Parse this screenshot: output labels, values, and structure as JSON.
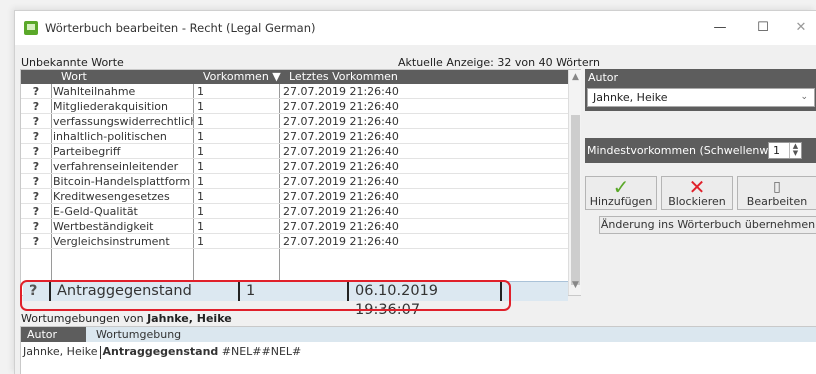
{
  "window": {
    "title": "Wörterbuch bearbeiten - Recht (Legal German)",
    "minimize": "—",
    "maximize": "☐",
    "close": "✕"
  },
  "left": {
    "label": "Unbekannte Worte",
    "count_label": "Aktuelle Anzeige: 32 von 40 Wörtern",
    "columns": [
      "Wort",
      "Vorkommen ▼",
      "Letztes Vorkommen"
    ],
    "rows": [
      {
        "q": "?",
        "word": "Wahlteilnahme",
        "count": "1",
        "date": "27.07.2019 21:26:40"
      },
      {
        "q": "?",
        "word": "Mitgliederakquisition",
        "count": "1",
        "date": "27.07.2019 21:26:40"
      },
      {
        "q": "?",
        "word": "verfassungswiderrechtliche",
        "count": "1",
        "date": "27.07.2019 21:26:40"
      },
      {
        "q": "?",
        "word": "inhaltlich-politischen",
        "count": "1",
        "date": "27.07.2019 21:26:40"
      },
      {
        "q": "?",
        "word": "Parteibegriff",
        "count": "1",
        "date": "27.07.2019 21:26:40"
      },
      {
        "q": "?",
        "word": "verfahrenseinleitender",
        "count": "1",
        "date": "27.07.2019 21:26:40"
      },
      {
        "q": "?",
        "word": "Bitcoin-Handelsplattform",
        "count": "1",
        "date": "27.07.2019 21:26:40"
      },
      {
        "q": "?",
        "word": "Kreditwesengesetzes",
        "count": "1",
        "date": "27.07.2019 21:26:40"
      },
      {
        "q": "?",
        "word": "E-Geld-Qualität",
        "count": "1",
        "date": "27.07.2019 21:26:40"
      },
      {
        "q": "?",
        "word": "Wertbeständigkeit",
        "count": "1",
        "date": "27.07.2019 21:26:40"
      },
      {
        "q": "?",
        "word": "Vergleichsinstrument",
        "count": "1",
        "date": "27.07.2019 21:26:40"
      }
    ],
    "selected_row": {
      "q": "?",
      "word": "Antraggegenstand",
      "count": "1",
      "date": "06.10.2019 19:36:07"
    }
  },
  "right": {
    "autor_label": "Autor",
    "autor_value": "Jahnke, Heike",
    "mindest_label": "Mindestvorkommen (Schwellenwert):",
    "mindest_value": "1",
    "buttons": {
      "add": "Hinzufügen",
      "block": "Blockieren",
      "edit": "Bearbeiten"
    },
    "apply": "Änderung ins Wörterbuch übernehmen"
  },
  "context": {
    "label_prefix": "Wortumgebungen von",
    "label_name": "Jahnke, Heike",
    "col_autor": "Autor",
    "col_umgebung": "Wortumgebung",
    "row_autor": "Jahnke, Heike",
    "row_word": "Antraggegenstand",
    "row_rest": "#NEL##NEL#"
  },
  "colors": {
    "header_bg": "#5d5d5d",
    "selection_bg": "#dce8f1",
    "highlight_border": "#e0202a",
    "accent_green": "#5aa829",
    "accent_red": "#e0202a"
  }
}
